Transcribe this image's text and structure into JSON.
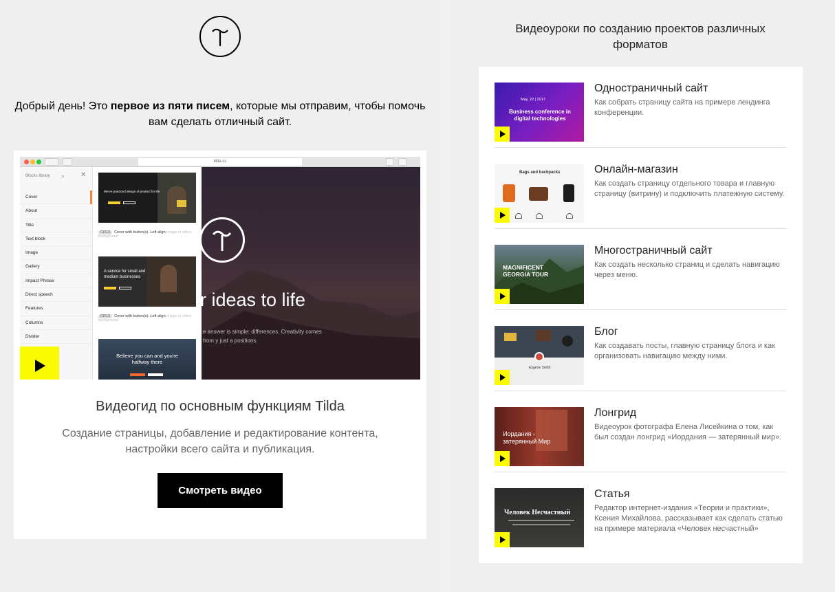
{
  "intro": {
    "part1": "Добрый день! Это ",
    "bold": "первое из пяти писем",
    "part2": ", которые мы отправим, чтобы помочь вам сделать отличный сайт."
  },
  "screenshot": {
    "url": "tilda.cc",
    "library_header": "Blocks library",
    "library_items": [
      "Cover",
      "About",
      "Title",
      "Text block",
      "Image",
      "Gallery",
      "Impact Phrase",
      "Direct speech",
      "Features",
      "Columns",
      "Divider"
    ],
    "cards": [
      {
        "text": "We've practiced design of product for life",
        "tag": "CR13",
        "caption": "Cover with button(s). Left align",
        "faint": "image or video background"
      },
      {
        "text": "A service for small and medium businesses",
        "tag": "CR13",
        "caption": "Cover with button(s). Left align",
        "faint": "image or video background"
      },
      {
        "text": "Believe you can and you're halfway there",
        "tag": "",
        "caption": "",
        "faint": ""
      }
    ],
    "hero_title": "r ideas to life",
    "hero_sub": "e answer is simple: differences. Creativity comes from y just a positions."
  },
  "card": {
    "title": "Видеогид по основным функциям Tilda",
    "desc_line1": "Создание страницы, добавление и редактирование контента,",
    "desc_line2": "настройки всего сайта и публикация.",
    "button": "Смотреть видео"
  },
  "right": {
    "title_line1": "Видеоуроки по созданию проектов различных",
    "title_line2": "форматов",
    "items": [
      {
        "title": "Одностраничный сайт",
        "desc": "Как собрать страницу сайта на примере лендинга конференции.",
        "thumb_label": "Business conference in digital technologies",
        "thumb_date": "May, 22 | 2017"
      },
      {
        "title": "Онлайн-магазин",
        "desc": "Как создать страницу отдельного товара и главную страницу (витрину) и подключить платежную систему.",
        "thumb_label": "Bags and backpacks"
      },
      {
        "title": "Многостраничный сайт",
        "desc": "Как создать несколько страниц и сделать навигацию через меню.",
        "thumb_label": "MAGNIFICENT GEORGIA TOUR"
      },
      {
        "title": "Блог",
        "desc": "Как создавать посты, главную страницу блога и как организовать навигацию между ними.",
        "thumb_label": "Eugene Smith"
      },
      {
        "title": "Лонгрид",
        "desc": "Видеоурок фотографа Елена Лисейкина о том, как был создан лонгрид «Иордания — затерянный мир».",
        "thumb_label": "Иордания - затерянный Мир"
      },
      {
        "title": "Статья",
        "desc": "Редактор интернет-издания «Теории и практики», Ксения Михайлова, рассказывает как сделать статью на примере материала «Человек несчастный»",
        "thumb_label": "Человек Несчастный"
      }
    ]
  },
  "colors": {
    "accent": "#fafa00",
    "button": "#000000",
    "background": "#efefef"
  }
}
